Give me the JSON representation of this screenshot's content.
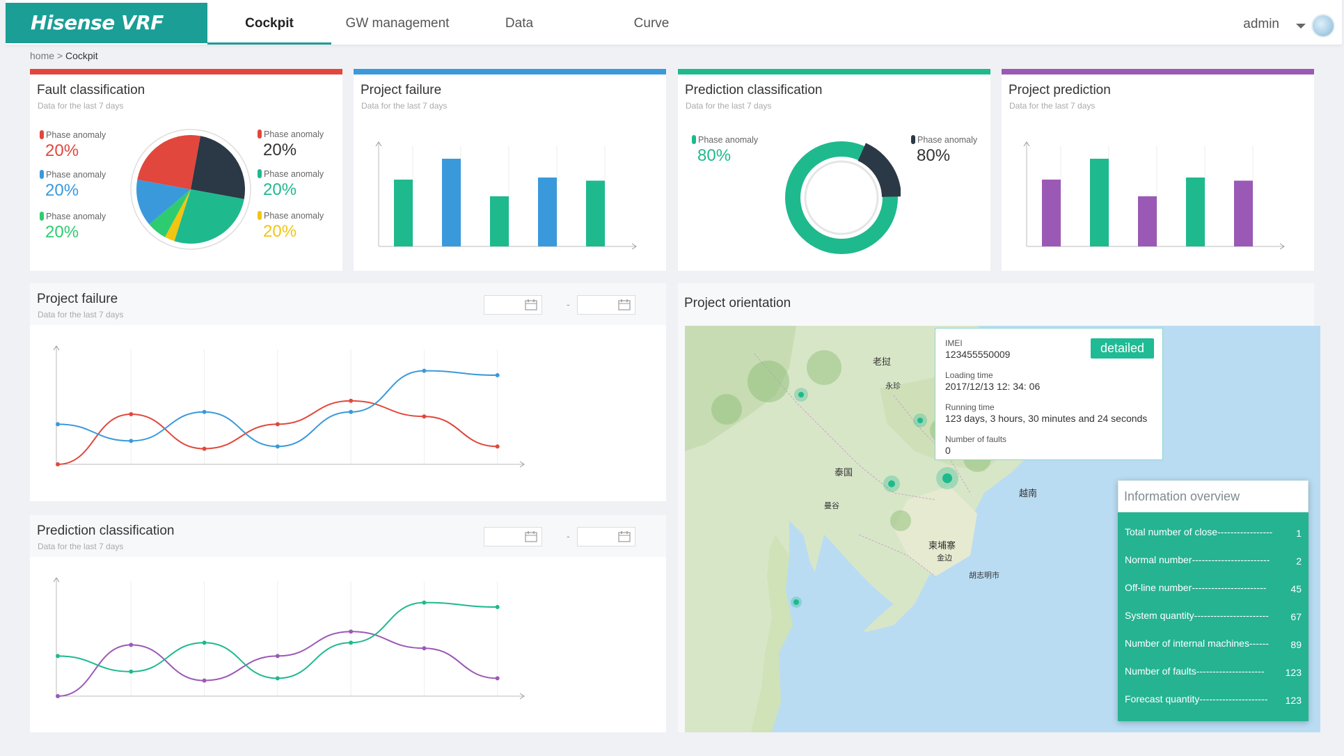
{
  "brand": "Hisense VRF",
  "nav": {
    "tabs": [
      "Cockpit",
      "GW management",
      "Data",
      "Curve"
    ],
    "active": 0
  },
  "user": {
    "name": "admin"
  },
  "breadcrumb": {
    "home": "home",
    "sep": ">",
    "current": "Cockpit"
  },
  "subtitle": "Data for the last 7 days",
  "colors": {
    "red": "#e1473c",
    "blue": "#3a99db",
    "green": "#1fb98e",
    "dark": "#2b3845",
    "yellow": "#f2c511",
    "lime": "#2ecc71",
    "purple": "#9b59b6",
    "teal": "#1a9e96"
  },
  "cards": {
    "fault": {
      "title": "Fault classification",
      "legend": [
        {
          "label": "Phase anomaly",
          "pct": "20%",
          "color": "#e1473c"
        },
        {
          "label": "Phase anomaly",
          "pct": "20%",
          "color": "#3a99db"
        },
        {
          "label": "Phase anomaly",
          "pct": "20%",
          "color": "#2ecc71"
        },
        {
          "label": "Phase anomaly",
          "pct": "20%",
          "color": "#2b3845"
        },
        {
          "label": "Phase anomaly",
          "pct": "20%",
          "color": "#1fb98e"
        },
        {
          "label": "Phase anomaly",
          "pct": "20%",
          "color": "#f2c511"
        }
      ]
    },
    "project_failure": {
      "title": "Project failure"
    },
    "prediction_class": {
      "title": "Prediction classification",
      "legend": [
        {
          "label": "Phase anomaly",
          "pct": "80%",
          "color": "#1fb98e"
        },
        {
          "label": "Phase anomaly",
          "pct": "80%",
          "color": "#2b3845"
        }
      ]
    },
    "project_prediction": {
      "title": "Project prediction"
    }
  },
  "panels": {
    "failure_line": {
      "title": "Project failure"
    },
    "prediction_line": {
      "title": "Prediction classification"
    },
    "orientation": {
      "title": "Project orientation"
    }
  },
  "date_sep": "-",
  "chart_data": [
    {
      "type": "pie",
      "title": "Fault classification",
      "slices": [
        {
          "value": 25,
          "color": "#2b3845"
        },
        {
          "value": 27,
          "color": "#1fb98e"
        },
        {
          "value": 3,
          "color": "#f2c511"
        },
        {
          "value": 6,
          "color": "#2ecc71"
        },
        {
          "value": 14,
          "color": "#3a99db"
        },
        {
          "value": 25,
          "color": "#e1473c"
        }
      ]
    },
    {
      "type": "bar",
      "title": "Project failure",
      "values": [
        64,
        84,
        48,
        66,
        63
      ],
      "colors": [
        "#1fb98e",
        "#3a99db",
        "#1fb98e",
        "#3a99db",
        "#1fb98e"
      ],
      "ylim": [
        0,
        100
      ]
    },
    {
      "type": "pie",
      "title": "Prediction classification",
      "slices": [
        {
          "value": 82,
          "color": "#1fb98e"
        },
        {
          "value": 18,
          "color": "#2b3845"
        }
      ]
    },
    {
      "type": "bar",
      "title": "Project prediction",
      "values": [
        64,
        84,
        48,
        66,
        63
      ],
      "colors": [
        "#9b59b6",
        "#1fb98e",
        "#9b59b6",
        "#1fb98e",
        "#9b59b6"
      ],
      "ylim": [
        0,
        100
      ]
    },
    {
      "type": "line",
      "title": "Project failure",
      "x": [
        0,
        1,
        2,
        3,
        4,
        5,
        6
      ],
      "ylim": [
        0,
        100
      ],
      "series": [
        {
          "color": "#e1473c",
          "values": [
            0,
            45,
            14,
            36,
            57,
            43,
            16
          ]
        },
        {
          "color": "#3a99db",
          "values": [
            36,
            21,
            47,
            16,
            47,
            84,
            80
          ]
        }
      ]
    },
    {
      "type": "line",
      "title": "Prediction classification",
      "x": [
        0,
        1,
        2,
        3,
        4,
        5,
        6
      ],
      "ylim": [
        0,
        100
      ],
      "series": [
        {
          "color": "#9b59b6",
          "values": [
            0,
            46,
            14,
            36,
            58,
            43,
            16
          ]
        },
        {
          "color": "#1fb98e",
          "values": [
            36,
            22,
            48,
            16,
            48,
            84,
            80
          ]
        }
      ]
    }
  ],
  "map": {
    "labels": [
      "老挝",
      "泰国",
      "越南",
      "柬埔寨",
      "永珍",
      "曼谷",
      "胡志明市",
      "金边"
    ],
    "popup": {
      "imei_label": "IMEI",
      "imei": "123455550009",
      "loading_label": "Loading time",
      "loading": "2017/12/13 12: 34: 06",
      "running_label": "Running time",
      "running": "123 days, 3 hours, 30 minutes and 24 seconds",
      "faults_label": "Number of faults",
      "faults": "0",
      "button": "detailed"
    },
    "overview": {
      "title": "Information overview",
      "rows": [
        {
          "label": "Total number of close-----------------",
          "value": "1"
        },
        {
          "label": "Normal number------------------------",
          "value": "2"
        },
        {
          "label": "Off-line number-----------------------",
          "value": "45"
        },
        {
          "label": "System quantity-----------------------",
          "value": "67"
        },
        {
          "label": "Number of internal machines------",
          "value": "89"
        },
        {
          "label": "Number of faults---------------------",
          "value": "123"
        },
        {
          "label": "Forecast quantity---------------------",
          "value": "123"
        }
      ]
    }
  }
}
